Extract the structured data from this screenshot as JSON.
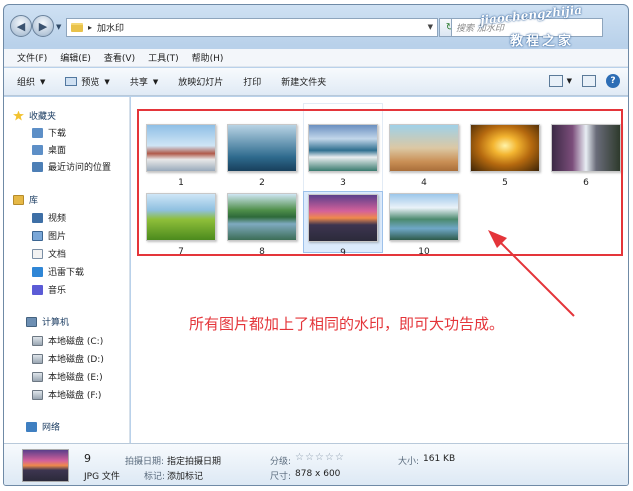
{
  "window": {
    "address_path": "加水印",
    "search_placeholder": "搜索 加水印"
  },
  "watermark": {
    "url": "jiaochengzhijia",
    "cn": "教程之家"
  },
  "menubar": [
    "文件(F)",
    "编辑(E)",
    "查看(V)",
    "工具(T)",
    "帮助(H)"
  ],
  "toolbar": {
    "organize": "组织",
    "preview": "预览",
    "share": "共享",
    "slideshow": "放映幻灯片",
    "print": "打印",
    "new_folder": "新建文件夹"
  },
  "navpane": {
    "favorites": "收藏夹",
    "fav_items": [
      "下载",
      "桌面",
      "最近访问的位置"
    ],
    "libraries": "库",
    "lib_items": [
      "视频",
      "图片",
      "文档",
      "迅雷下载",
      "音乐"
    ],
    "computer": "计算机",
    "disks": [
      "本地磁盘 (C:)",
      "本地磁盘 (D:)",
      "本地磁盘 (E:)",
      "本地磁盘 (F:)"
    ],
    "network": "网络"
  },
  "files": [
    {
      "name": "1",
      "thumb": "p1"
    },
    {
      "name": "2",
      "thumb": "p2"
    },
    {
      "name": "3",
      "thumb": "p3"
    },
    {
      "name": "4",
      "thumb": "p4"
    },
    {
      "name": "5",
      "thumb": "p5"
    },
    {
      "name": "6",
      "thumb": "p6"
    },
    {
      "name": "7",
      "thumb": "p7"
    },
    {
      "name": "8",
      "thumb": "p8"
    },
    {
      "name": "9",
      "thumb": "p9"
    },
    {
      "name": "10",
      "thumb": "p10"
    }
  ],
  "annotation": "所有图片都加上了相同的水印，即可大功告成。",
  "details": {
    "name": "9",
    "type": "JPG 文件",
    "date_label": "拍摄日期:",
    "date_value": "指定拍摄日期",
    "tags_label": "标记:",
    "tags_value": "添加标记",
    "rating_label": "分级:",
    "rating_stars": "☆☆☆☆☆",
    "dims_label": "尺寸:",
    "dims_value": "878 x 600",
    "size_label": "大小:",
    "size_value": "161 KB"
  },
  "colors": {
    "annotation_red": "#e4353a",
    "selection": "#dcebfc"
  }
}
